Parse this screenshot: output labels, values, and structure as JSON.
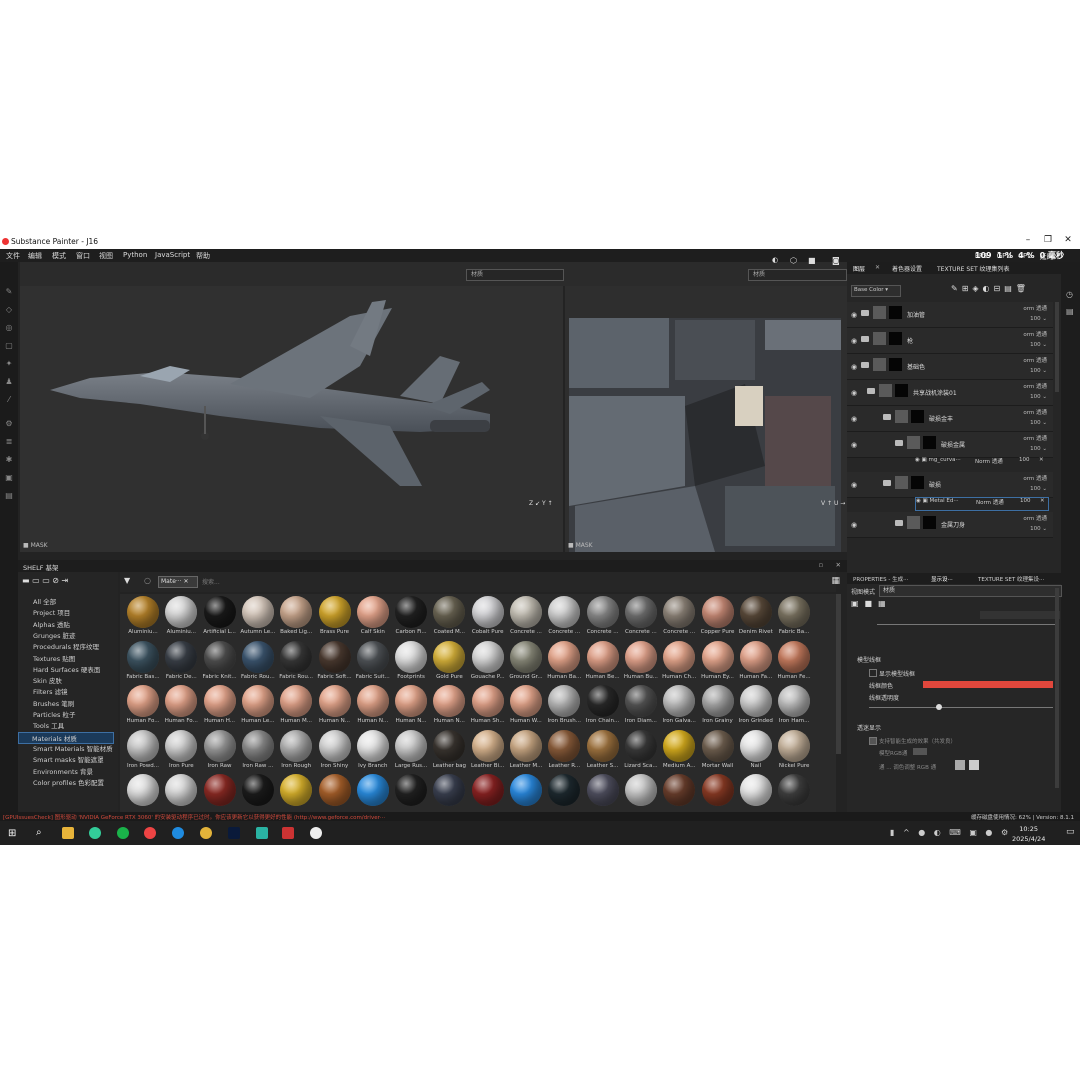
{
  "window": {
    "title": "Substance Painter - J16"
  },
  "menu": [
    "文件",
    "编辑",
    "模式",
    "窗口",
    "视图",
    "Python",
    "JavaScript",
    "帮助"
  ],
  "perf": {
    "fps_label": "FPS",
    "fps": "109",
    "gpu_label": "GPU",
    "gpu": "1 %",
    "cpu_label": "CPU",
    "cpu": "4 %",
    "latency_label": "延时",
    "latency": "0 毫秒"
  },
  "viewport": {
    "left_dropdown": "材质",
    "right_dropdown": "材质",
    "mask_label": "MASK"
  },
  "shelf": {
    "title": "SHELF 基架",
    "filter_chip": "Mate···",
    "search_placeholder": "搜索...",
    "categories": [
      "All 全部",
      "Project 项目",
      "Alphas 透贴",
      "Grunges 脏迹",
      "Procedurals 程序纹理",
      "Textures 贴图",
      "Hard Surfaces 硬表面",
      "Skin 皮肤",
      "Filters 滤镜",
      "Brushes 笔刷",
      "Particles 粒子",
      "Tools 工具",
      "Materials 材质",
      "Smart Materials 智能材质",
      "Smart masks 智能遮罩",
      "Environments 背景",
      "Color profiles 色彩配置"
    ],
    "selected_category": "Materials 材质",
    "materials": [
      {
        "label": "Aluminiu...",
        "color": "#b7832a"
      },
      {
        "label": "Aluminiu...",
        "color": "#d8d8d8"
      },
      {
        "label": "Artificial L...",
        "color": "#1a1a1a"
      },
      {
        "label": "Autumn Le...",
        "color": "#d7c9bd"
      },
      {
        "label": "Baked Lig...",
        "color": "#c9a68d"
      },
      {
        "label": "Brass Pure",
        "color": "#d2a62b"
      },
      {
        "label": "Calf Skin",
        "color": "#e6a58c"
      },
      {
        "label": "Carbon Fi...",
        "color": "#222222"
      },
      {
        "label": "Coated M...",
        "color": "#6a6453"
      },
      {
        "label": "Cobalt Pure",
        "color": "#d5d5d8"
      },
      {
        "label": "Concrete ...",
        "color": "#c4bfb4"
      },
      {
        "label": "Concrete ...",
        "color": "#d0d0d0"
      },
      {
        "label": "Concrete ...",
        "color": "#8a8a8a"
      },
      {
        "label": "Concrete ...",
        "color": "#707070"
      },
      {
        "label": "Concrete ...",
        "color": "#8d8378"
      },
      {
        "label": "Copper Pure",
        "color": "#c88a76"
      },
      {
        "label": "Denim Rivet",
        "color": "#5a4a3a"
      },
      {
        "label": "Fabric Ba...",
        "color": "#7c7462"
      },
      {
        "label": "Fabric Bas...",
        "color": "#3e5563"
      },
      {
        "label": "Fabric De...",
        "color": "#3a4048"
      },
      {
        "label": "Fabric Knit...",
        "color": "#505050"
      },
      {
        "label": "Fabric Rou...",
        "color": "#3c5670"
      },
      {
        "label": "Fabric Rou...",
        "color": "#383838"
      },
      {
        "label": "Fabric Soft...",
        "color": "#4b3a30"
      },
      {
        "label": "Fabric Suit...",
        "color": "#505458"
      },
      {
        "label": "Footprints",
        "color": "#e0e0e0"
      },
      {
        "label": "Gold Pure",
        "color": "#d7b23a"
      },
      {
        "label": "Gouache P...",
        "color": "#d8d8d8"
      },
      {
        "label": "Ground Gr...",
        "color": "#8a8a7a"
      },
      {
        "label": "Human Ba...",
        "color": "#e4a48a"
      },
      {
        "label": "Human Be...",
        "color": "#e0a088"
      },
      {
        "label": "Human Bu...",
        "color": "#e3a38c"
      },
      {
        "label": "Human Ch...",
        "color": "#e5a68c"
      },
      {
        "label": "Human Ey...",
        "color": "#e6a78e"
      },
      {
        "label": "Human Fa...",
        "color": "#e2a28a"
      },
      {
        "label": "Human Fe...",
        "color": "#c67b5e"
      },
      {
        "label": "Human Fo...",
        "color": "#e4a48a"
      },
      {
        "label": "Human Fo...",
        "color": "#e3a38a"
      },
      {
        "label": "Human H...",
        "color": "#e5a58c"
      },
      {
        "label": "Human Le...",
        "color": "#e4a58b"
      },
      {
        "label": "Human M...",
        "color": "#e2a38a"
      },
      {
        "label": "Human N...",
        "color": "#e5a68c"
      },
      {
        "label": "Human N...",
        "color": "#e3a48a"
      },
      {
        "label": "Human N...",
        "color": "#e4a58b"
      },
      {
        "label": "Human N...",
        "color": "#e6a68d"
      },
      {
        "label": "Human Sh...",
        "color": "#e3a38a"
      },
      {
        "label": "Human W...",
        "color": "#e4a58b"
      },
      {
        "label": "Iron Brush...",
        "color": "#b8b8b8"
      },
      {
        "label": "Iron Chain...",
        "color": "#2a2a2a"
      },
      {
        "label": "Iron Diam...",
        "color": "#555555"
      },
      {
        "label": "Iron Galva...",
        "color": "#c0c0c0"
      },
      {
        "label": "Iron Grainy",
        "color": "#a9a9a9"
      },
      {
        "label": "Iron Grinded",
        "color": "#cfcfcf"
      },
      {
        "label": "Iron Ham...",
        "color": "#bfbfbf"
      },
      {
        "label": "Iron Powd...",
        "color": "#c8c8c8"
      },
      {
        "label": "Iron Pure",
        "color": "#d0d0d0"
      },
      {
        "label": "Iron Raw",
        "color": "#9a9a9a"
      },
      {
        "label": "Iron Raw ...",
        "color": "#8c8c8c"
      },
      {
        "label": "Iron Rough",
        "color": "#b0b0b0"
      },
      {
        "label": "Iron Shiny",
        "color": "#d2d2d2"
      },
      {
        "label": "Ivy Branch",
        "color": "#e6e6e6"
      },
      {
        "label": "Large Rus...",
        "color": "#cccccc"
      },
      {
        "label": "Leather bag",
        "color": "#3a3530"
      },
      {
        "label": "Leather Bi...",
        "color": "#d8b48e"
      },
      {
        "label": "Leather M...",
        "color": "#caa884"
      },
      {
        "label": "Leather R...",
        "color": "#8a5c3a"
      },
      {
        "label": "Leather S...",
        "color": "#a07440"
      },
      {
        "label": "Lizard Sca...",
        "color": "#3a3a3a"
      },
      {
        "label": "Medium A...",
        "color": "#d6ad1e"
      },
      {
        "label": "Mortar Wall",
        "color": "#706050"
      },
      {
        "label": "Nail",
        "color": "#e8e8e8"
      },
      {
        "label": "Nickel Pure",
        "color": "#c6b39c"
      },
      {
        "label": "",
        "color": "#e0e0e0"
      },
      {
        "label": "",
        "color": "#d8d8d8"
      },
      {
        "label": "",
        "color": "#8c2a24"
      },
      {
        "label": "",
        "color": "#1c1c1c"
      },
      {
        "label": "",
        "color": "#d9b22c"
      },
      {
        "label": "",
        "color": "#a8602a"
      },
      {
        "label": "",
        "color": "#2a8de0"
      },
      {
        "label": "",
        "color": "#222222"
      },
      {
        "label": "",
        "color": "#3a4050"
      },
      {
        "label": "",
        "color": "#8a2222"
      },
      {
        "label": "",
        "color": "#2a8ae0"
      },
      {
        "label": "",
        "color": "#1e2a30"
      },
      {
        "label": "",
        "color": "#505060"
      },
      {
        "label": "",
        "color": "#c8c8c8"
      },
      {
        "label": "",
        "color": "#6a3e2c"
      },
      {
        "label": "",
        "color": "#8a3a24"
      },
      {
        "label": "",
        "color": "#e6e6e6"
      },
      {
        "label": "",
        "color": "#404040"
      }
    ]
  },
  "right_panel": {
    "tabs": [
      "图层",
      "着色器设置",
      "TEXTURE SET 纹理集列表"
    ],
    "channel": "Base Color",
    "layers": [
      {
        "name": "加油管",
        "blend": "orm 透通",
        "opacity": "100"
      },
      {
        "name": "枪",
        "blend": "orm 透通",
        "opacity": "100"
      },
      {
        "name": "基础色",
        "blend": "orm 透通",
        "opacity": "100"
      },
      {
        "name": "共享战机涂装01",
        "blend": "orm 透通",
        "opacity": "100"
      },
      {
        "name": "破损金丰",
        "blend": "orm 透通",
        "opacity": "100"
      },
      {
        "name": "破损金属",
        "blend": "orm 透通",
        "opacity": "100"
      },
      {
        "name": "破损",
        "blend": "orm 透通",
        "opacity": "100"
      },
      {
        "name": "金属刀身",
        "blend": "orm 透通",
        "opacity": "100"
      }
    ],
    "sublayers": [
      {
        "name": "mg_curva···",
        "blend": "Norm 透通",
        "opacity": "100"
      },
      {
        "name": "Metal Ed···",
        "blend": "Norm 透通",
        "opacity": "100"
      }
    ]
  },
  "properties": {
    "tabs": [
      "PROPERTIES - 生成···",
      "显示设···",
      "TEXTURE SET 纹理集设···"
    ],
    "view_mode_label": "视图模式",
    "view_mode_value": "材质",
    "section_wireframe": "模型线框",
    "show_wireframe": "显示模型线框",
    "wire_color": "线框颜色",
    "wire_color_value": "#e0473c",
    "wire_opacity": "线框透明度",
    "wire_opacity_level": 0.88,
    "section_overlay": "透迷显示",
    "overlay_option1": "支持智能生成的效果（共发良）",
    "overlay_option2": "模型RGB通",
    "overlay_option3": "通 ...  调色调整 RGB 通"
  },
  "status_bar": {
    "message": "[GPUIssuesCheck] 图形驱动 'NVIDIA GeForce RTX 3060' 的安装驱动程序已过时。你应该更新它以获得更好的性能 (http://www.geforce.com/driver···",
    "cache": "缓存磁盘使用情况: 62% | Version: 8.1.1"
  },
  "taskbar": {
    "time": "10:25",
    "date": "2025/4/24"
  }
}
